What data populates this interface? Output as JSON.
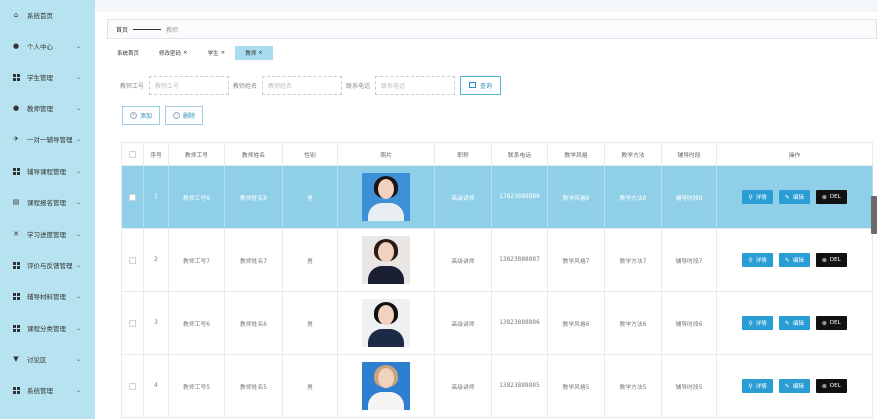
{
  "sidebar": {
    "items": [
      {
        "label": "系统首页",
        "icon": "home-icon",
        "arrow": ""
      },
      {
        "label": "个人中心",
        "icon": "user-icon",
        "arrow": "⌄"
      },
      {
        "label": "学生管理",
        "icon": "grid-icon",
        "arrow": "⌄"
      },
      {
        "label": "教师管理",
        "icon": "bulb-icon",
        "arrow": "⌄"
      },
      {
        "label": "一对一辅导管理",
        "icon": "rocket-icon",
        "arrow": "⌄"
      },
      {
        "label": "辅导课程管理",
        "icon": "grid-icon",
        "arrow": "⌄"
      },
      {
        "label": "课程报名管理",
        "icon": "doc-icon",
        "arrow": "⌄"
      },
      {
        "label": "学习进度管理",
        "icon": "cross-icon",
        "arrow": "⌄"
      },
      {
        "label": "评价与反馈管理",
        "icon": "grid-icon",
        "arrow": "⌄"
      },
      {
        "label": "辅导材料管理",
        "icon": "grid-icon",
        "arrow": "⌄"
      },
      {
        "label": "课程分类管理",
        "icon": "grid-icon",
        "arrow": "⌄"
      },
      {
        "label": "讨论区",
        "icon": "cup-icon",
        "arrow": "⌄"
      },
      {
        "label": "系统管理",
        "icon": "grid-icon",
        "arrow": "⌄"
      }
    ]
  },
  "breadcrumb": {
    "home": "首页",
    "current": "教师"
  },
  "tabs": [
    {
      "label": "系统首页",
      "closable": false,
      "active": false
    },
    {
      "label": "修改密码",
      "closable": true,
      "active": false
    },
    {
      "label": "学生",
      "closable": true,
      "active": false
    },
    {
      "label": "教师",
      "closable": true,
      "active": true
    }
  ],
  "search": {
    "id_label": "教师工号",
    "id_placeholder": "教师工号",
    "name_label": "教师姓名",
    "name_placeholder": "教师姓名",
    "phone_label": "联系电话",
    "phone_placeholder": "联系电话",
    "query_label": "查询"
  },
  "actions": {
    "add_label": "添加",
    "delete_label": "删除"
  },
  "table": {
    "headers": [
      "",
      "序号",
      "教师工号",
      "教师姓名",
      "性别",
      "照片",
      "职称",
      "联系电话",
      "教学风格",
      "教学方法",
      "辅导时段",
      "操作"
    ],
    "detail_label": "详情",
    "edit_label": "编辑",
    "del_label": "DEL",
    "rows": [
      {
        "index": "1",
        "id": "教师工号8",
        "name": "教师姓名8",
        "gender": "男",
        "title": "高级讲师",
        "phone": "13823888888",
        "style": "教学风格8",
        "method": "教学方法8",
        "slot": "辅导时段8",
        "selected": true,
        "photo": {
          "bg": "#3d8fd6",
          "suit": "#e9eef3",
          "hair": "#1b1410"
        }
      },
      {
        "index": "2",
        "id": "教师工号7",
        "name": "教师姓名7",
        "gender": "男",
        "title": "高级讲师",
        "phone": "13823888887",
        "style": "教学风格7",
        "method": "教学方法7",
        "slot": "辅导时段7",
        "selected": false,
        "photo": {
          "bg": "#e9e6e3",
          "suit": "#1a1f33",
          "hair": "#2a1c14"
        }
      },
      {
        "index": "3",
        "id": "教师工号6",
        "name": "教师姓名6",
        "gender": "男",
        "title": "高级讲师",
        "phone": "13823888886",
        "style": "教学风格6",
        "method": "教学方法6",
        "slot": "辅导时段6",
        "selected": false,
        "photo": {
          "bg": "#eef0f2",
          "suit": "#1c2a45",
          "hair": "#111"
        }
      },
      {
        "index": "4",
        "id": "教师工号5",
        "name": "教师姓名5",
        "gender": "男",
        "title": "高级讲师",
        "phone": "13823888885",
        "style": "教学风格5",
        "method": "教学方法5",
        "slot": "辅导时段5",
        "selected": false,
        "photo": {
          "bg": "#2f7fd0",
          "suit": "#f4f4f4",
          "hair": "#c9a27a"
        }
      }
    ]
  },
  "colors": {
    "sidebar_bg": "#b7e3f0",
    "selected_row": "#8fd0e8",
    "primary": "#2a9dd4",
    "danger": "#111111"
  }
}
